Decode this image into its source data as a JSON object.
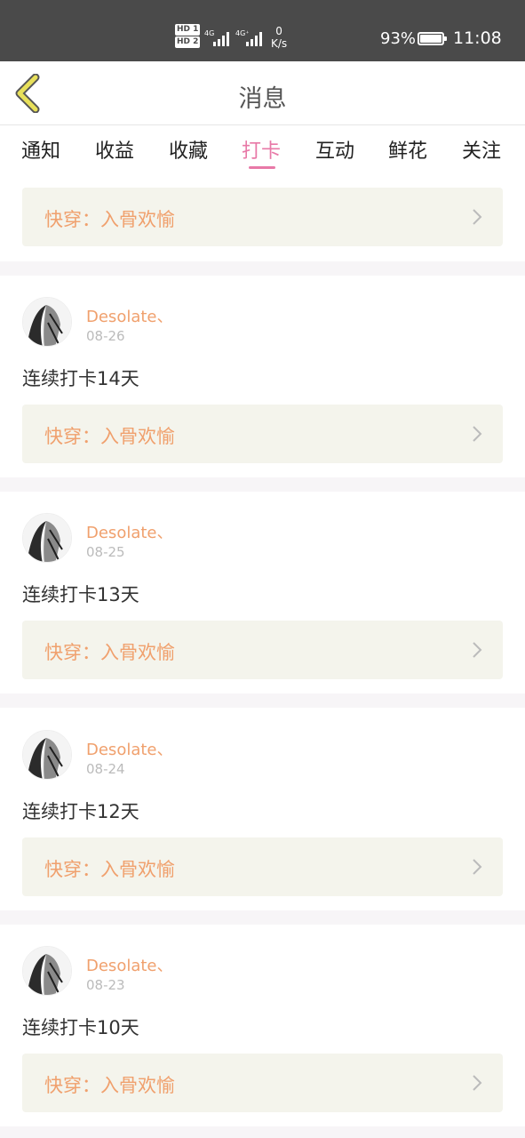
{
  "status_bar": {
    "hd1": "HD 1",
    "hd2": "HD 2",
    "net1": "4G",
    "net2": "4G⁺",
    "speed_value": "0",
    "speed_unit": "K/s",
    "battery": "93%",
    "time": "11:08"
  },
  "header": {
    "title": "消息",
    "back_icon": "chevron-left-icon",
    "accent_color": "#e8e05a"
  },
  "tabs": [
    {
      "label": "通知",
      "active": false
    },
    {
      "label": "收益",
      "active": false
    },
    {
      "label": "收藏",
      "active": false
    },
    {
      "label": "打卡",
      "active": true
    },
    {
      "label": "互动",
      "active": false
    },
    {
      "label": "鲜花",
      "active": false
    },
    {
      "label": "关注",
      "active": false
    }
  ],
  "colors": {
    "active_tab": "#e879a7",
    "book_title": "#f0a06d",
    "username": "#f0a06d",
    "card_bg": "#f4f4ec"
  },
  "top_card": {
    "book_title": "快穿：入骨欢愉"
  },
  "posts": [
    {
      "username": "Desolate、",
      "date": "08-26",
      "text": "连续打卡14天",
      "book_title": "快穿：入骨欢愉"
    },
    {
      "username": "Desolate、",
      "date": "08-25",
      "text": "连续打卡13天",
      "book_title": "快穿：入骨欢愉"
    },
    {
      "username": "Desolate、",
      "date": "08-24",
      "text": "连续打卡12天",
      "book_title": "快穿：入骨欢愉"
    },
    {
      "username": "Desolate、",
      "date": "08-23",
      "text": "连续打卡10天",
      "book_title": "快穿：入骨欢愉"
    }
  ]
}
